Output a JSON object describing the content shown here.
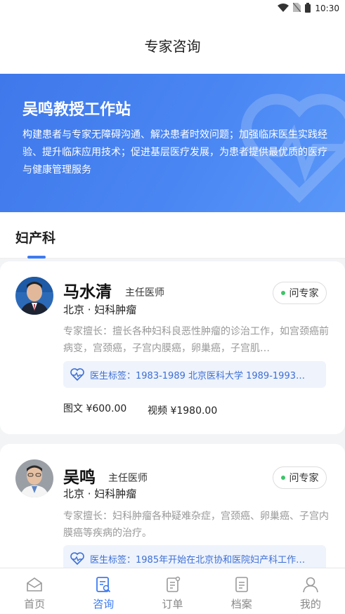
{
  "status": {
    "time": "10:30"
  },
  "header": {
    "title": "专家咨询"
  },
  "banner": {
    "title": "吴鸣教授工作站",
    "description": "构建患者与专家无障碍沟通、解决患者时效问题；加强临床医生实践经验、提升临床应用技术；促进基层医疗发展，为患者提供最优质的医疗与健康管理服务"
  },
  "tabs": [
    {
      "label": "妇产科",
      "active": true
    }
  ],
  "doctors": [
    {
      "name": "马水清",
      "rank": "主任医师",
      "dept": "北京 · 妇科肿瘤",
      "ask": "问专家",
      "skill": "专家擅长：擅长各种妇科良恶性肿瘤的诊治工作，如宫颈癌前病变，宫颈癌，子宫内膜癌，卵巢癌，子宫肌…",
      "tags": "医生标签：1983-1989  北京医科大学 1989-1993…",
      "price_text": "图文 ¥600.00",
      "price_video": "视频 ¥1980.00"
    },
    {
      "name": "吴鸣",
      "rank": "主任医师",
      "dept": "北京 · 妇科肿瘤",
      "ask": "问专家",
      "skill": "专家擅长：妇科肿瘤各种疑难杂症，宫颈癌、卵巢癌、子宫内膜癌等疾病的治疗。",
      "tags": "医生标签：1985年开始在北京协和医院妇产科工作…"
    }
  ],
  "nav": [
    {
      "label": "首页",
      "icon": "home-icon"
    },
    {
      "label": "咨询",
      "icon": "consult-icon",
      "active": true
    },
    {
      "label": "订单",
      "icon": "order-icon"
    },
    {
      "label": "档案",
      "icon": "record-icon"
    },
    {
      "label": "我的",
      "icon": "profile-icon"
    }
  ],
  "colors": {
    "accent": "#3d7bf0",
    "online": "#3dc469",
    "tag_bg": "#eef3fc"
  }
}
